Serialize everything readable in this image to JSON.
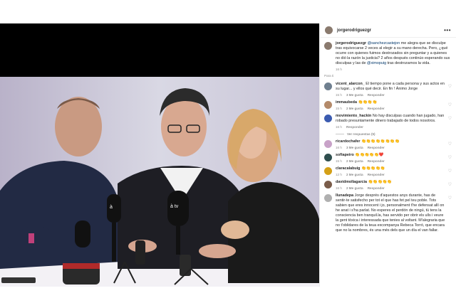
{
  "post": {
    "author": "jorgerodriguezgr",
    "caption": {
      "author": "jorgerodriguezgr",
      "mention1": "@sanchezcastejon",
      "text1": " me alegra que se disculpe tras equivocarse 2 veces al elegir a su mano derecha. Pero, ¿qué ocurre con quienes fuimos destrozados sin preguntar y a quienes no dió la razón la justicia? 2 años después continúo esperando sus disculpas y las de ",
      "mention2": "@ximopuig",
      "text2": " tras destrozarnos la vida.",
      "time": "16 h"
    },
    "translate_label": "Para ti",
    "more_icon": "more-horizontal-icon"
  },
  "labels": {
    "likes": "Me gusta",
    "reply": "Responder",
    "view_replies": "Ver respuestas (5)"
  },
  "comments": [
    {
      "user": "vicent_alarcon_",
      "text": "El tiempo pone a cada persona y sus actos en su lugar... y ellos qué decir. En fin ! Ánimo Jorge",
      "time": "15 h",
      "likes": "3 Me gusta",
      "avatar_color": "#6f7f8f"
    },
    {
      "user": "immaubeda",
      "text": "👏👏👏👏",
      "time": "15 h",
      "likes": "2 Me gusta",
      "avatar_color": "#b48a6a"
    },
    {
      "user": "movimiento_hackin",
      "text": "No hay disculpas cuando han jugado, han robado presuntamente dinero trabajado de todos nosotros.",
      "time": "16 h",
      "likes": "",
      "avatar_color": "#3b5bb0",
      "view_replies": true
    },
    {
      "user": "ricardochafer",
      "text": "👏👏👏👏👏👏👏👏",
      "time": "16 h",
      "likes": "3 Me gusta",
      "avatar_color": "#c8a2c8"
    },
    {
      "user": "sofiapeiro",
      "text": "👏👏👏👏👏❤️",
      "time": "15 h",
      "likes": "2 Me gusta",
      "avatar_color": "#2f4f4f"
    },
    {
      "user": "claracalabuig",
      "text": "👏👏👏👏👏",
      "time": "12 h",
      "likes": "2 Me gusta",
      "avatar_color": "#d4a017"
    },
    {
      "user": "davidmollagarcia",
      "text": "👏👏👏👏👏",
      "time": "16 h",
      "likes": "2 Me gusta",
      "avatar_color": "#7a5c4a"
    },
    {
      "user": "llunadepa",
      "text": "Jorge després d'aquestos anys durante, has de sentir-te satisfecho per tot el que has fet pel teu poble. Tots sabien que eres innocent i jo, personalment t'he defensat allí on he anat i s'ha parlat. No esperes el perdón de ningú, tú tens la consciencia ben tranquil.la, has servido per obrir els ulls i veure la gent tòxica i interessada que tenies al voltant. M'alegraria que no t'oblidares de la teua excompanya Rebeca Torró, que encara que no la nombres, és una més dels que un día el van fallar.",
      "time": "",
      "likes": "",
      "avatar_color": "#b0b0b0"
    }
  ],
  "colors": {
    "mention": "#00376b",
    "meta": "#8e8e8e",
    "border": "#efefef"
  }
}
